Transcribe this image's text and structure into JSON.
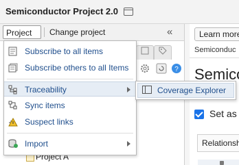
{
  "window": {
    "title": "Semiconductor Project 2.0"
  },
  "toolbar": {
    "project_label": "Project",
    "change_project_label": "Change project",
    "collapse_glyph": "«"
  },
  "tree": {
    "item_label": "Project A"
  },
  "right_panel": {
    "learn_more": "Learn more",
    "breadcrumb": "Semiconduc",
    "heading": "Semico",
    "checkbox_label": "Set as",
    "relationships_label": "Relationsh"
  },
  "project_menu": {
    "items": [
      {
        "label": "Subscribe to all items",
        "icon": "subscribe-icon"
      },
      {
        "label": "Subscribe others to all Items",
        "icon": "subscribe-others-icon"
      },
      {
        "label": "Traceability",
        "icon": "traceability-icon",
        "has_submenu": true,
        "active": true
      },
      {
        "label": "Sync items",
        "icon": "sync-icon"
      },
      {
        "label": "Suspect links",
        "icon": "suspect-links-icon"
      },
      {
        "label": "Import",
        "icon": "import-icon",
        "has_submenu": true
      }
    ]
  },
  "traceability_submenu": {
    "items": [
      {
        "label": "Coverage Explorer",
        "icon": "coverage-explorer-icon"
      }
    ]
  },
  "colors": {
    "menu_text": "#1f4e8c",
    "active_bg": "#e6edf5",
    "checkbox": "#1a73e8"
  }
}
